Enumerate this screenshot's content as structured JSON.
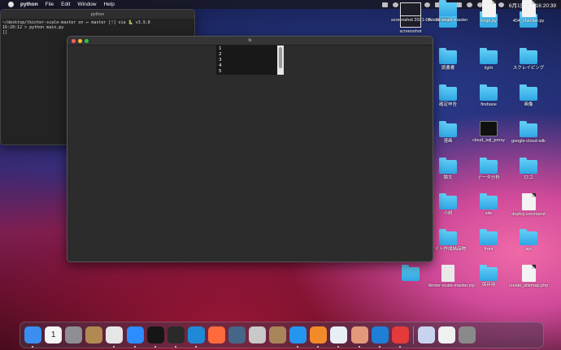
{
  "menubar": {
    "app": "python",
    "items": [
      "File",
      "Edit",
      "Window",
      "Help"
    ],
    "clock": "6月1日(火) 16:20:39"
  },
  "terminal": {
    "title": "python",
    "lines": [
      "~/desktop/tkinter-scale-master on ⭠ master [!] via 🐍 v3.9.8",
      "16:20:12 > python main.py",
      "[]"
    ]
  },
  "tk_window": {
    "title": "tk",
    "listbox_items": [
      "1",
      "2",
      "3",
      "4",
      "5"
    ]
  },
  "desktop": {
    "icons": [
      {
        "label": "screenshot",
        "kind": "shot"
      },
      {
        "label": "",
        "kind": "folder"
      },
      {
        "label": "",
        "kind": "folder"
      },
      {
        "label": "",
        "kind": "folder"
      },
      {
        "label": "",
        "kind": "folder"
      },
      {
        "label": "読書書",
        "kind": "folder"
      },
      {
        "label": "light",
        "kind": "folder"
      },
      {
        "label": "スクレイピング",
        "kind": "folder"
      },
      {
        "label": "",
        "kind": "folder"
      },
      {
        "label": "確定申告",
        "kind": "folder"
      },
      {
        "label": "firebase",
        "kind": "folder"
      },
      {
        "label": "画像",
        "kind": "folder"
      },
      {
        "label": "",
        "kind": "folder"
      },
      {
        "label": "漫画",
        "kind": "folder"
      },
      {
        "label": "cloud_sql_proxy",
        "kind": "terminal"
      },
      {
        "label": "google-cloud-sdk",
        "kind": "folder"
      },
      {
        "label": "",
        "kind": "folder"
      },
      {
        "label": "論文",
        "kind": "folder"
      },
      {
        "label": "データ分析",
        "kind": "folder"
      },
      {
        "label": "ロゴ",
        "kind": "folder"
      },
      {
        "label": "",
        "kind": "folder"
      },
      {
        "label": "小説",
        "kind": "folder"
      },
      {
        "label": "site",
        "kind": "folder"
      },
      {
        "label": "deploy.command",
        "kind": "doc"
      },
      {
        "label": "",
        "kind": "folder"
      },
      {
        "label": "サイト作成納品物",
        "kind": "folder"
      },
      {
        "label": "front",
        "kind": "folder"
      },
      {
        "label": "api",
        "kind": "folder"
      },
      {
        "label": "",
        "kind": "folder"
      },
      {
        "label": "tkinter-scale-master.zip",
        "kind": "zip"
      },
      {
        "label": "保存用",
        "kind": "folder"
      },
      {
        "label": "create_sitemap.php",
        "kind": "doc"
      },
      {
        "label": "screenshot 2021-06....03.png",
        "kind": "shot"
      },
      {
        "label": "tkinter-scale-master",
        "kind": "folder"
      },
      {
        "label": "hoge.py",
        "kind": "doc"
      },
      {
        "label": "404_checker.py",
        "kind": "doc"
      }
    ]
  },
  "dock": {
    "apps": [
      {
        "name": "finder",
        "color": "#3a8ef0",
        "dot": true
      },
      {
        "name": "calendar",
        "color": "#f5f5f5",
        "text": "1",
        "dot": false
      },
      {
        "name": "system-preferences",
        "color": "#8e8e93",
        "dot": false
      },
      {
        "name": "keychain",
        "color": "#b08a50",
        "dot": false
      },
      {
        "name": "chrome",
        "color": "#e6e6e6",
        "dot": true
      },
      {
        "name": "zoom",
        "color": "#2d8cff",
        "dot": true
      },
      {
        "name": "iterm",
        "color": "#161616",
        "dot": true
      },
      {
        "name": "terminal",
        "color": "#2a2a2a",
        "dot": true
      },
      {
        "name": "vscode",
        "color": "#1e8ad6",
        "dot": true
      },
      {
        "name": "safari",
        "color": "#ff6a3d",
        "dot": false
      },
      {
        "name": "quicktime",
        "color": "#446688",
        "dot": false
      },
      {
        "name": "sequel",
        "color": "#c8c8c8",
        "dot": false
      },
      {
        "name": "archive",
        "color": "#a9865a",
        "dot": false
      },
      {
        "name": "docker",
        "color": "#2496ed",
        "dot": true
      },
      {
        "name": "sourcetree",
        "color": "#f28a2a",
        "dot": true
      },
      {
        "name": "postgres",
        "color": "#e8eef6",
        "dot": true
      },
      {
        "name": "preview",
        "color": "#e39a7a",
        "dot": true
      },
      {
        "name": "arduino",
        "color": "#1e7fd6",
        "dot": true
      },
      {
        "name": "clock",
        "color": "#e43a3a",
        "dot": true
      },
      {
        "name": "photo-viewer",
        "color": "#c8d4ee",
        "dot": false
      },
      {
        "name": "document",
        "color": "#f0f0f0",
        "dot": false
      },
      {
        "name": "trash",
        "color": "#8a8a8a",
        "dot": false
      }
    ]
  }
}
